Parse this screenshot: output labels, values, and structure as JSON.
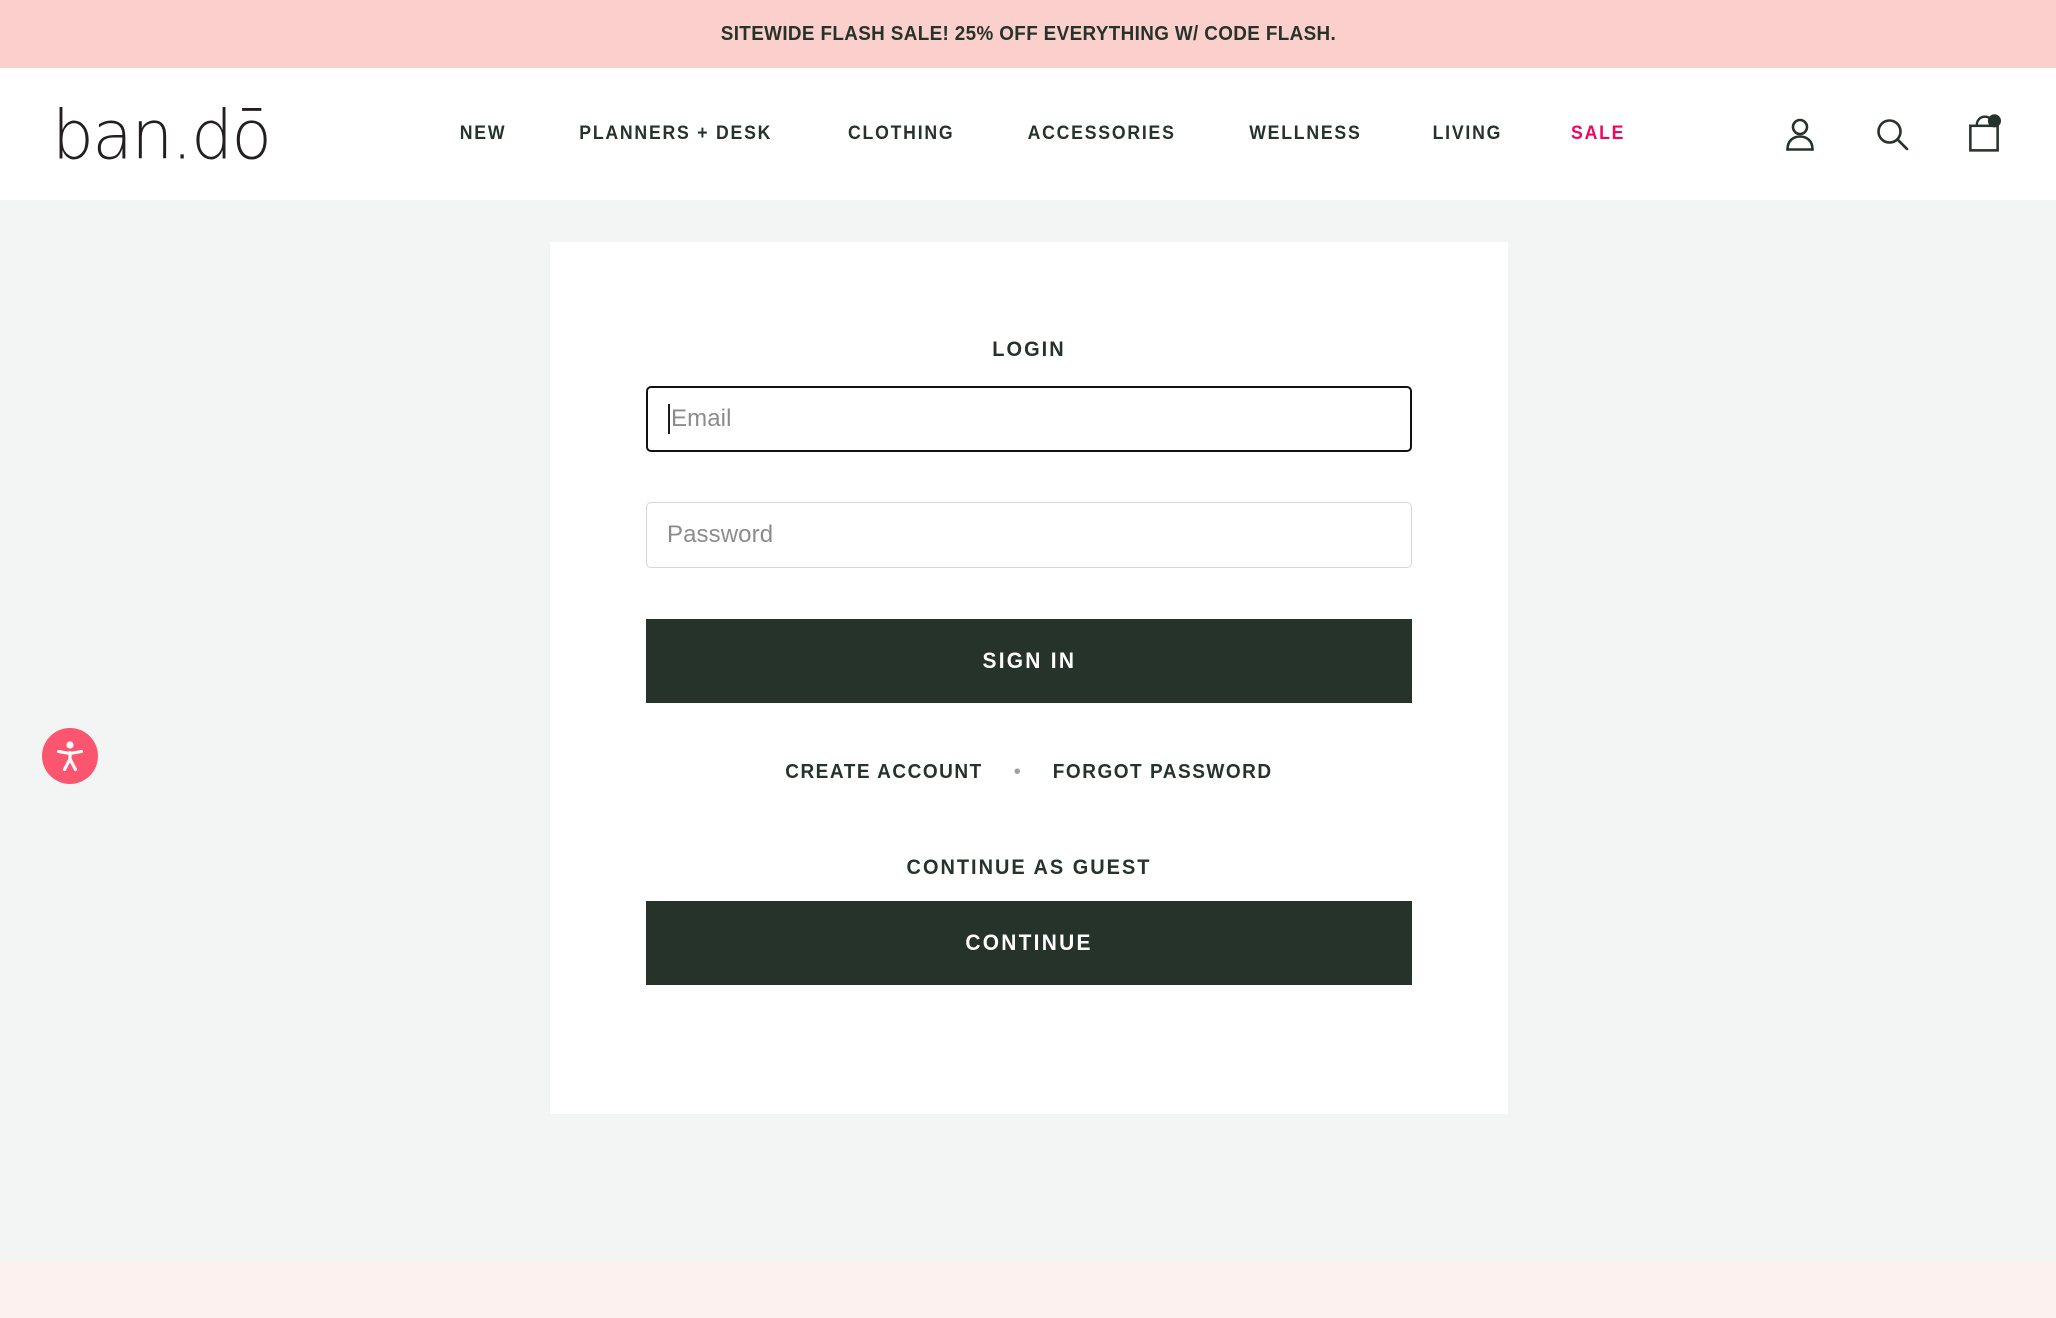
{
  "promo": {
    "text": "SITEWIDE FLASH SALE! 25% OFF EVERYTHING W/ CODE FLASH.",
    "background_color": "#FBCFCC",
    "text_color": "#26332A"
  },
  "header": {
    "logo_text": "ban.dō",
    "nav": [
      {
        "label": "NEW",
        "name": "nav-item-new",
        "accent": false
      },
      {
        "label": "PLANNERS + DESK",
        "name": "nav-item-planners-desk",
        "accent": false
      },
      {
        "label": "CLOTHING",
        "name": "nav-item-clothing",
        "accent": false
      },
      {
        "label": "ACCESSORIES",
        "name": "nav-item-accessories",
        "accent": false
      },
      {
        "label": "WELLNESS",
        "name": "nav-item-wellness",
        "accent": false
      },
      {
        "label": "LIVING",
        "name": "nav-item-living",
        "accent": false
      },
      {
        "label": "SALE",
        "name": "nav-item-sale",
        "accent": true
      }
    ],
    "icons": [
      {
        "name": "account-icon",
        "label": "Account"
      },
      {
        "name": "search-icon",
        "label": "Search"
      },
      {
        "name": "cart-icon",
        "label": "Cart",
        "has_badge": true
      }
    ],
    "sale_color": "#F2045F"
  },
  "login_card": {
    "title": "LOGIN",
    "email_field": {
      "placeholder": "Email",
      "value": "",
      "focused": true
    },
    "password_field": {
      "placeholder": "Password",
      "value": "",
      "focused": false
    },
    "sign_in_button": "SIGN IN",
    "create_account_link": "CREATE ACCOUNT",
    "separator": "•",
    "forgot_password_link": "FORGOT PASSWORD",
    "guest_title": "CONTINUE AS GUEST",
    "continue_button": "CONTINUE",
    "button_color": "#26332A"
  },
  "accessibility_widget": {
    "name": "accessibility-icon",
    "color": "#FB5570"
  }
}
